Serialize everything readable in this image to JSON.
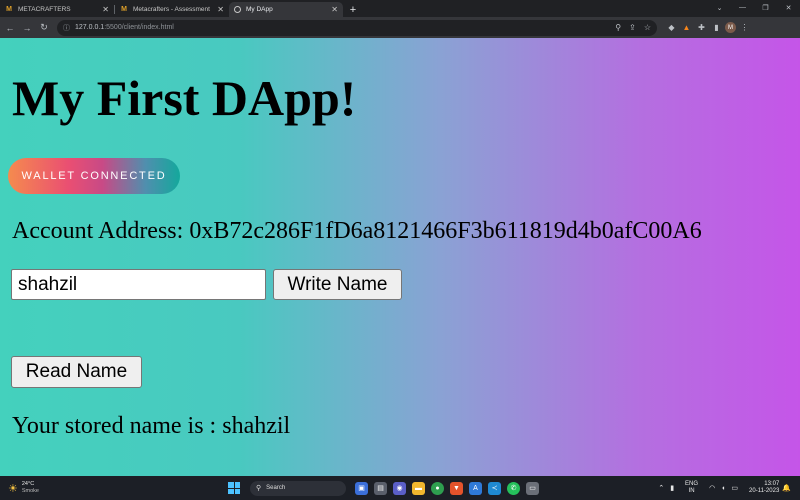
{
  "browser": {
    "tabs": [
      {
        "title": "METACRAFTERS",
        "favicon": "metacrafters-m-icon",
        "active": false
      },
      {
        "title": "Metacrafters - Assessment",
        "favicon": "metacrafters-m-icon",
        "active": false
      },
      {
        "title": "My DApp",
        "favicon": "globe-icon",
        "active": true
      }
    ],
    "new_tab": "+",
    "url_host": "127.0.0.1",
    "url_rest": ":5500/client/index.html"
  },
  "page": {
    "heading": "My First DApp!",
    "wallet_button": "WALLET CONNECTED",
    "account_label": "Account Address:",
    "account_address": "0xB72c286F1fD6a8121466F3b611819d4b0afC00A6",
    "name_input_value": "shahzil",
    "write_button": "Write Name",
    "read_button": "Read Name",
    "stored_name_text": "Your stored name is : shahzil"
  },
  "taskbar": {
    "weather_temp": "24°C",
    "weather_desc": "Smoke",
    "search_placeholder": "Search",
    "lang_top": "ENG",
    "lang_bottom": "IN",
    "time": "13:07",
    "date": "20-11-2023"
  },
  "colors": {
    "gradient_left": "#44d1bd",
    "gradient_right": "#c555e8"
  }
}
